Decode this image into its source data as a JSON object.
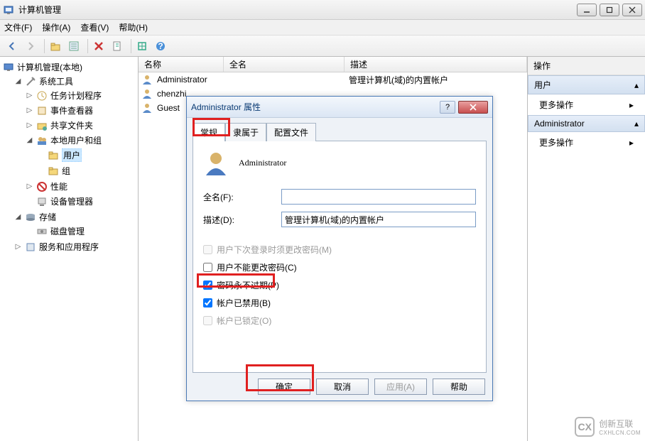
{
  "window": {
    "title": "计算机管理"
  },
  "menus": {
    "file": "文件(F)",
    "action": "操作(A)",
    "view": "查看(V)",
    "help": "帮助(H)"
  },
  "tree": {
    "root": "计算机管理(本地)",
    "sys_tools": "系统工具",
    "task_sched": "任务计划程序",
    "event_viewer": "事件查看器",
    "shared_folders": "共享文件夹",
    "local_users_groups": "本地用户和组",
    "users": "用户",
    "groups": "组",
    "performance": "性能",
    "device_mgr": "设备管理器",
    "storage": "存储",
    "disk_mgmt": "磁盘管理",
    "services_apps": "服务和应用程序"
  },
  "list": {
    "col_name": "名称",
    "col_fullname": "全名",
    "col_desc": "描述",
    "rows": [
      {
        "name": "Administrator",
        "fullname": "",
        "desc": "管理计算机(域)的内置帐户"
      },
      {
        "name": "chenzhi",
        "fullname": "",
        "desc": ""
      },
      {
        "name": "Guest",
        "fullname": "",
        "desc": ""
      }
    ]
  },
  "actions": {
    "header": "操作",
    "section_users": "用户",
    "more_actions": "更多操作",
    "section_admin": "Administrator"
  },
  "dialog": {
    "title": "Administrator 属性",
    "tabs": {
      "general": "常规",
      "memberof": "隶属于",
      "profile": "配置文件"
    },
    "username": "Administrator",
    "fullname_label": "全名(F):",
    "fullname_value": "",
    "desc_label": "描述(D):",
    "desc_value": "管理计算机(域)的内置帐户",
    "chk_must_change": "用户下次登录时须更改密码(M)",
    "chk_cannot_change": "用户不能更改密码(C)",
    "chk_never_expire": "密码永不过期(P)",
    "chk_disabled": "帐户已禁用(B)",
    "chk_locked": "帐户已锁定(O)",
    "btn_ok": "确定",
    "btn_cancel": "取消",
    "btn_apply": "应用(A)",
    "btn_help": "帮助"
  },
  "watermark": {
    "brand": "创新互联",
    "sub": "CXHLCN.COM"
  }
}
